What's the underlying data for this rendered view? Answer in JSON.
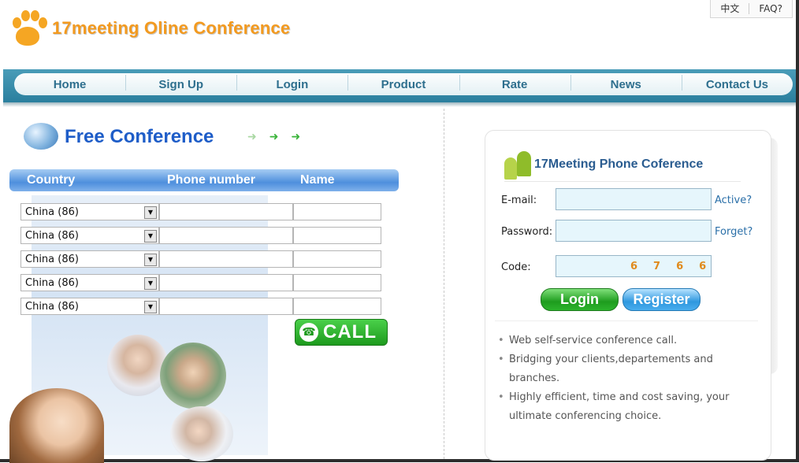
{
  "top_links": {
    "chinese": "中文",
    "faq": "FAQ?"
  },
  "logo": {
    "text": "17meeting Oline Conference"
  },
  "nav": {
    "items": [
      "Home",
      "Sign Up",
      "Login",
      "Product",
      "Rate",
      "News",
      "Contact Us"
    ]
  },
  "free_conference": {
    "title": "Free Conference",
    "columns": {
      "country": "Country",
      "phone": "Phone number",
      "name": "Name"
    },
    "rows": [
      {
        "country": "China (86)"
      },
      {
        "country": "China (86)"
      },
      {
        "country": "China (86)"
      },
      {
        "country": "China (86)"
      },
      {
        "country": "China (86)"
      }
    ],
    "call_button": "CALL"
  },
  "login_panel": {
    "title": "17Meeting Phone Coference",
    "email_label": "E-mail:",
    "password_label": "Password:",
    "code_label": "Code:",
    "active_link": "Active?",
    "forget_link": "Forget?",
    "captcha": [
      "6",
      "7",
      "6",
      "6"
    ],
    "login_button": "Login",
    "register_button": "Register",
    "features": [
      "Web self-service conference call.",
      "Bridging your clients,departements and branches.",
      "Highly efficient, time and cost saving, your ultimate conferencing choice."
    ]
  },
  "colors": {
    "accent_blue": "#2e6f8e",
    "logo_orange": "#f39a1f",
    "call_green": "#1d9a1d"
  }
}
